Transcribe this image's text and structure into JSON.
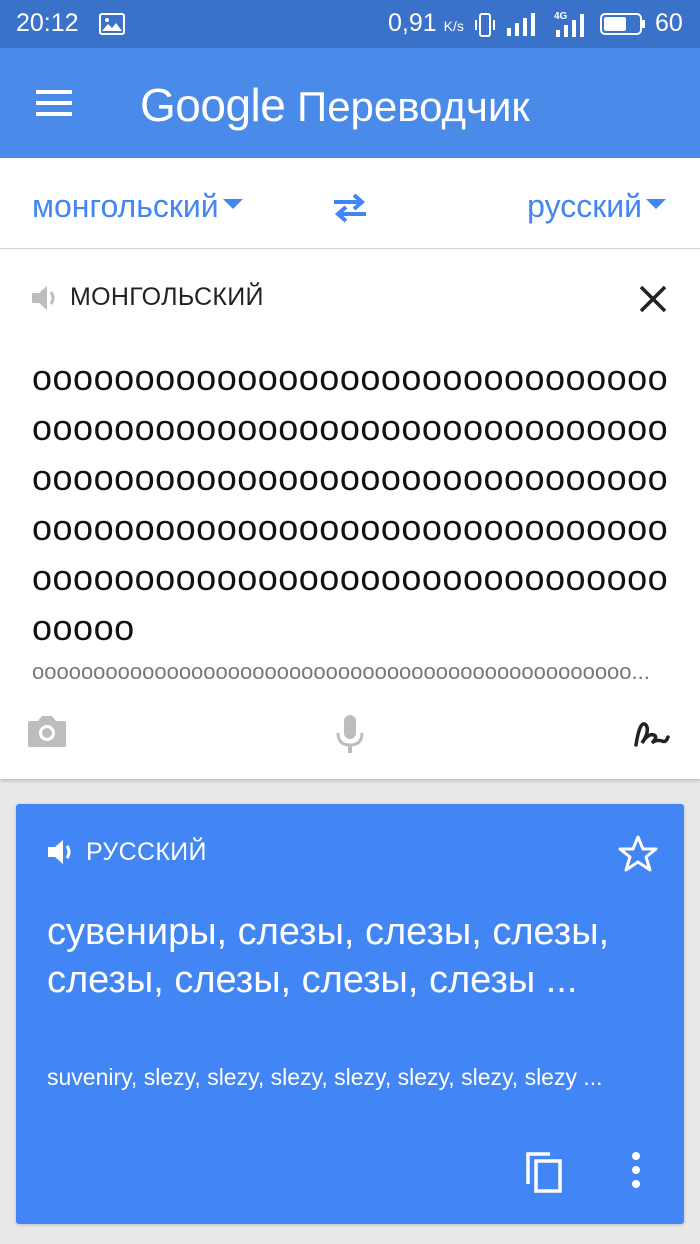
{
  "status": {
    "time": "20:12",
    "speed": "0,91",
    "speed_unit": "K/s",
    "network": "4G",
    "battery": "60"
  },
  "appbar": {
    "brand": "Google",
    "title": "Переводчик"
  },
  "languages": {
    "source": "монгольский",
    "target": "русский"
  },
  "input": {
    "label": "МОНГОЛЬСКИЙ",
    "text": "оооооооооооооооооооооооооооооооооооооооооооооооооооооооооооооооооооооооооооооооооооооооооооооооооооооооооооооооооооооооооооооооооооооооооооооооооооооооооооооооо",
    "transliteration": "ooooooooooooooooooooooooooooooooooooooooooooooooo..."
  },
  "result": {
    "label": "РУССКИЙ",
    "text": "сувениры, слезы, слезы, слезы, слезы, слезы, слезы, слезы ...",
    "transliteration": "suveniry, slezy, slezy, slezy, slezy, slezy, slezy, slezy ..."
  },
  "colors": {
    "statusbar": "#3a71c9",
    "appbar": "#4a8ae8",
    "accent": "#4285f4"
  },
  "icons": {
    "menu": "menu-icon",
    "swap": "swap-arrows-icon",
    "speaker": "speaker-icon",
    "close": "close-icon",
    "camera": "camera-icon",
    "mic": "microphone-icon",
    "handwriting": "handwriting-icon",
    "star": "star-icon",
    "copy": "copy-icon",
    "more": "more-vert-icon"
  }
}
